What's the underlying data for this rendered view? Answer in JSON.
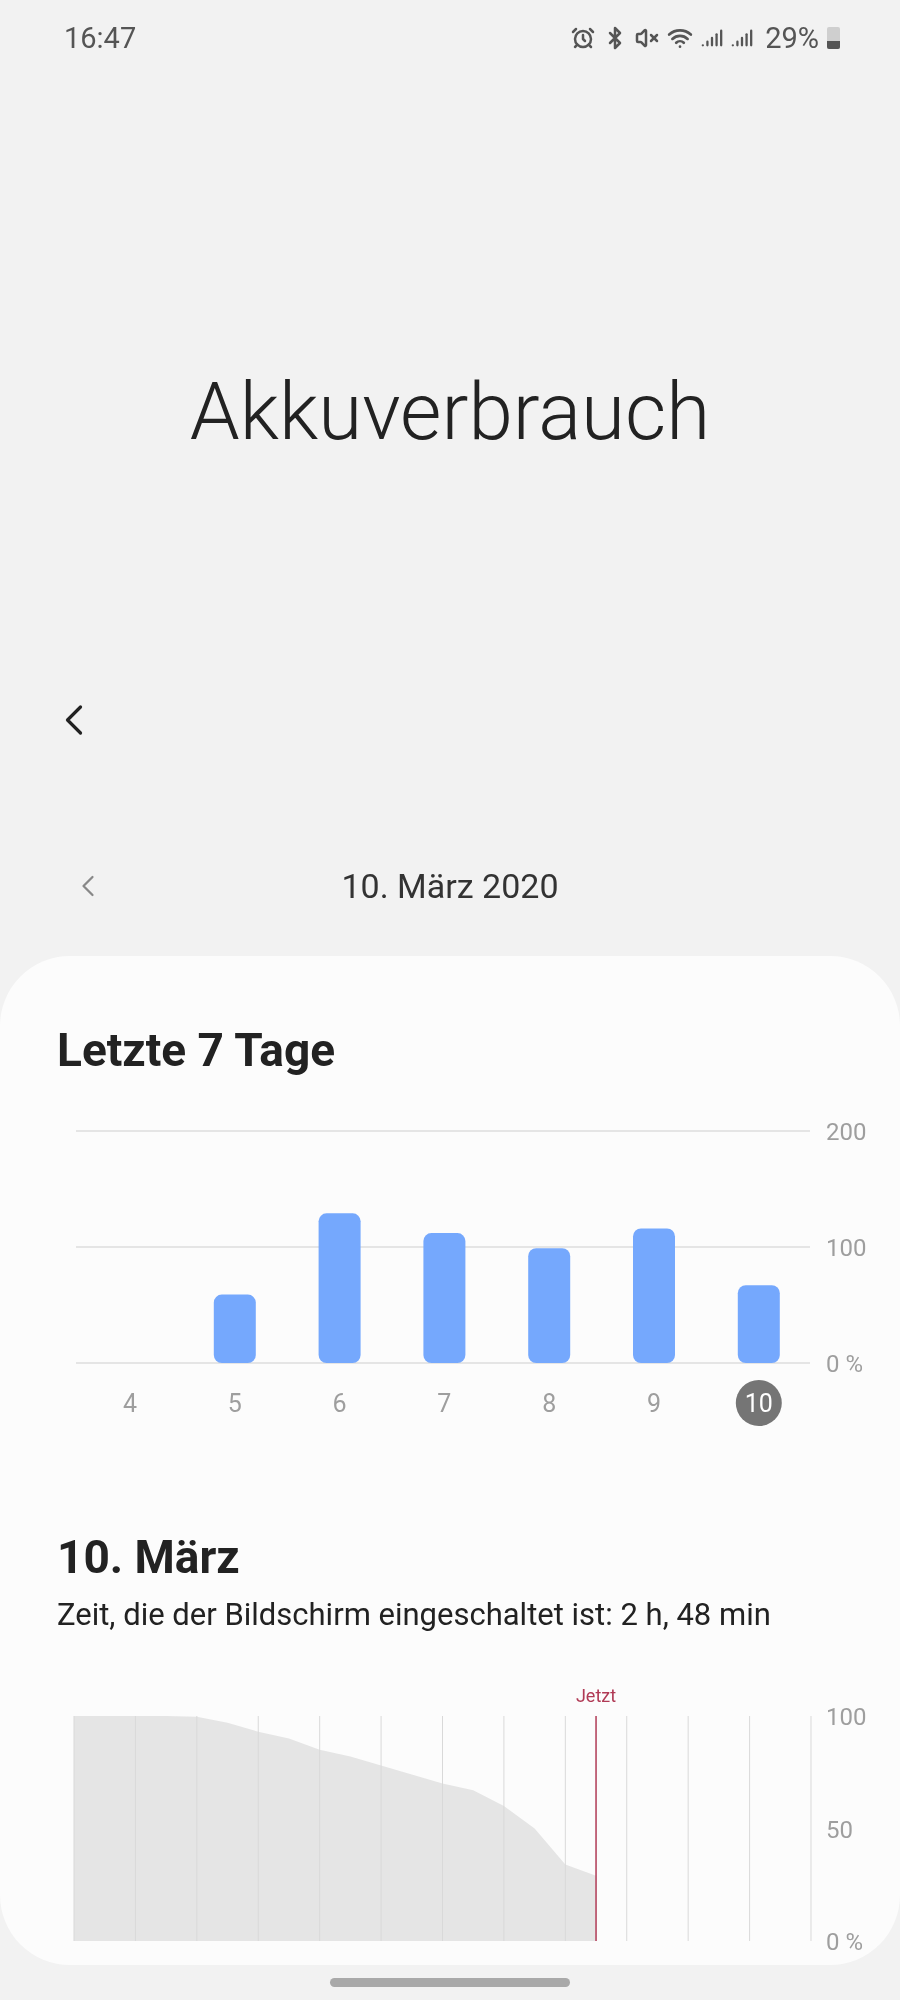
{
  "status_bar": {
    "time": "16:47",
    "battery": "29%"
  },
  "title": "Akkuverbrauch",
  "date_nav": {
    "date": "10. März 2020"
  },
  "weekly": {
    "title": "Letzte 7 Tage",
    "days_selected": [
      false,
      false,
      false,
      false,
      false,
      false,
      true
    ],
    "chart_data": {
      "type": "bar",
      "categories": [
        "4",
        "5",
        "6",
        "7",
        "8",
        "9",
        "10"
      ],
      "values": [
        null,
        59,
        129,
        112,
        99,
        116,
        67
      ],
      "ylim": [
        0,
        200
      ],
      "yticks": [
        {
          "value": 0,
          "label": "0 %"
        },
        100,
        200
      ],
      "color": "#75a8fd"
    }
  },
  "day": {
    "title": "10. März",
    "screen_time": "Zeit, die der Bildschirm eingeschaltet ist: 2 h, 48 min",
    "battery_graph": {
      "now_label": "Jetzt",
      "scale_labels": [
        "100",
        "50",
        "0 %"
      ]
    }
  }
}
